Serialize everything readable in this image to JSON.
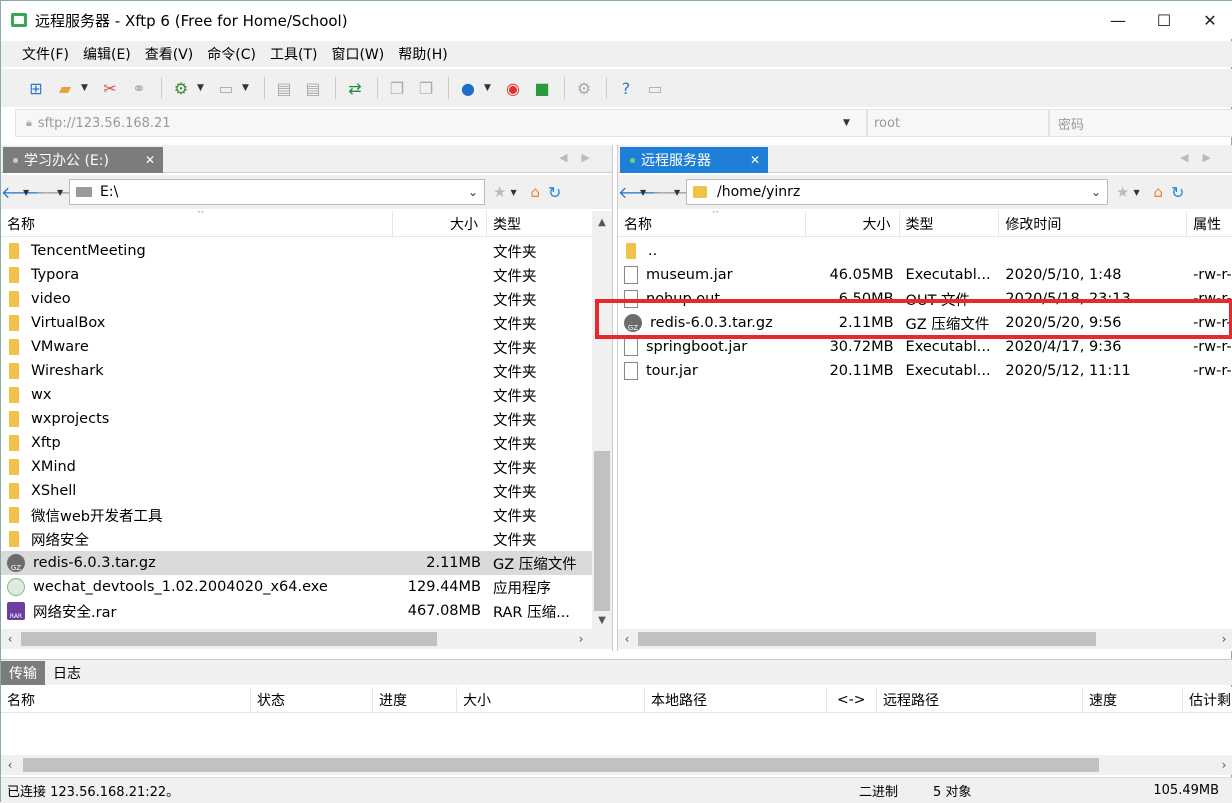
{
  "window": {
    "title": "远程服务器 - Xftp 6 (Free for Home/School)",
    "minimize": "—",
    "maximize": "☐",
    "close": "✕"
  },
  "menu": [
    "文件(F)",
    "编辑(E)",
    "查看(V)",
    "命令(C)",
    "工具(T)",
    "窗口(W)",
    "帮助(H)"
  ],
  "address": {
    "host_placeholder": "sftp://123.56.168.21",
    "user_placeholder": "root",
    "password_placeholder": "密码"
  },
  "left_pane": {
    "tab_label": "学习办公 (E:)",
    "path": "E:\\",
    "columns": [
      "名称",
      "大小",
      "类型"
    ],
    "rows": [
      {
        "name": "TencentMeeting",
        "size": "",
        "type": "文件夹",
        "icon": "folder-icon"
      },
      {
        "name": "Typora",
        "size": "",
        "type": "文件夹",
        "icon": "folder-icon"
      },
      {
        "name": "video",
        "size": "",
        "type": "文件夹",
        "icon": "folder-icon"
      },
      {
        "name": "VirtualBox",
        "size": "",
        "type": "文件夹",
        "icon": "folder-icon"
      },
      {
        "name": "VMware",
        "size": "",
        "type": "文件夹",
        "icon": "folder-icon"
      },
      {
        "name": "Wireshark",
        "size": "",
        "type": "文件夹",
        "icon": "folder-icon"
      },
      {
        "name": "wx",
        "size": "",
        "type": "文件夹",
        "icon": "folder-icon"
      },
      {
        "name": "wxprojects",
        "size": "",
        "type": "文件夹",
        "icon": "folder-icon"
      },
      {
        "name": "Xftp",
        "size": "",
        "type": "文件夹",
        "icon": "folder-icon"
      },
      {
        "name": "XMind",
        "size": "",
        "type": "文件夹",
        "icon": "folder-icon"
      },
      {
        "name": "XShell",
        "size": "",
        "type": "文件夹",
        "icon": "folder-icon"
      },
      {
        "name": "微信web开发者工具",
        "size": "",
        "type": "文件夹",
        "icon": "folder-icon"
      },
      {
        "name": "网络安全",
        "size": "",
        "type": "文件夹",
        "icon": "folder-icon"
      },
      {
        "name": "redis-6.0.3.tar.gz",
        "size": "2.11MB",
        "type": "GZ 压缩文件",
        "icon": "gz-archive-icon",
        "selected": true
      },
      {
        "name": "wechat_devtools_1.02.2004020_x64.exe",
        "size": "129.44MB",
        "type": "应用程序",
        "icon": "exe-icon"
      },
      {
        "name": "网络安全.rar",
        "size": "467.08MB",
        "type": "RAR 压缩...",
        "icon": "rar-archive-icon"
      }
    ]
  },
  "right_pane": {
    "tab_label": "远程服务器",
    "path": "/home/yinrz",
    "columns": [
      "名称",
      "大小",
      "类型",
      "修改时间",
      "属性"
    ],
    "rows": [
      {
        "name": "..",
        "size": "",
        "type": "",
        "modified": "",
        "attr": "",
        "icon": "folder-icon"
      },
      {
        "name": "museum.jar",
        "size": "46.05MB",
        "type": "Executabl...",
        "modified": "2020/5/10, 1:48",
        "attr": "-rw-r-",
        "icon": "file-icon"
      },
      {
        "name": "nohup.out",
        "size": "6.50MB",
        "type": "OUT 文件",
        "modified": "2020/5/18, 23:13",
        "attr": "-rw-r-",
        "icon": "file-icon"
      },
      {
        "name": "redis-6.0.3.tar.gz",
        "size": "2.11MB",
        "type": "GZ 压缩文件",
        "modified": "2020/5/20, 9:56",
        "attr": "-rw-r-",
        "icon": "gz-archive-icon"
      },
      {
        "name": "springboot.jar",
        "size": "30.72MB",
        "type": "Executabl...",
        "modified": "2020/4/17, 9:36",
        "attr": "-rw-r-",
        "icon": "file-icon"
      },
      {
        "name": "tour.jar",
        "size": "20.11MB",
        "type": "Executabl...",
        "modified": "2020/5/12, 11:11",
        "attr": "-rw-r-",
        "icon": "file-icon"
      }
    ]
  },
  "transfer": {
    "tabs": [
      "传输",
      "日志"
    ],
    "columns": [
      "名称",
      "状态",
      "进度",
      "大小",
      "本地路径",
      "<->",
      "远程路径",
      "速度",
      "估计剩"
    ]
  },
  "status": {
    "connection": "已连接 123.56.168.21:22。",
    "mode": "二进制",
    "objects": "5 对象",
    "size": "105.49MB"
  },
  "colors": {
    "active_tab": "#1e7fd6",
    "inactive_tab": "#7c7c7c",
    "highlight": "#e8282c",
    "folder": "#f2c04b"
  }
}
